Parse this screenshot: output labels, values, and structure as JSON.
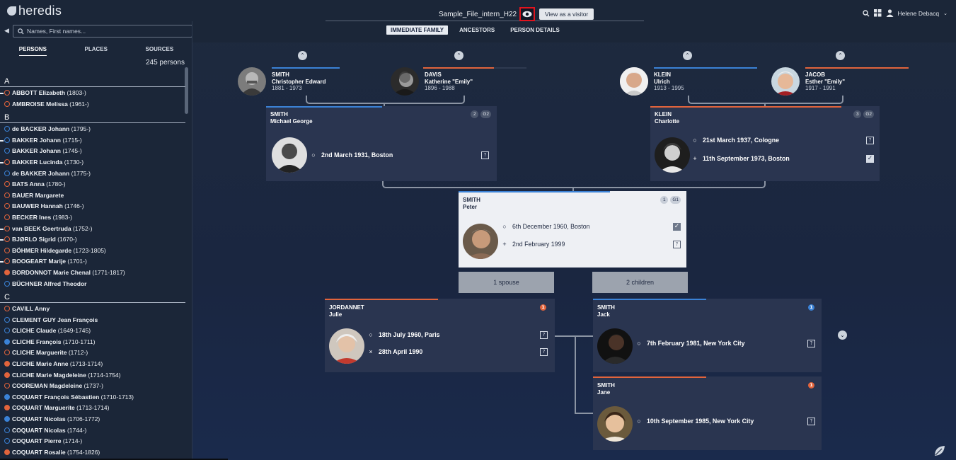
{
  "app": {
    "logo": "heredis"
  },
  "header": {
    "filename": "Sample_File_intern_H22",
    "visitor_label": "View as a visitor",
    "tabs": [
      {
        "label": "IMMEDIATE FAMILY",
        "active": true
      },
      {
        "label": "ANCESTORS",
        "active": false
      },
      {
        "label": "PERSON DETAILS",
        "active": false
      }
    ],
    "user": "Helene Debacq"
  },
  "sidebar": {
    "search_placeholder": "Names, First names...",
    "tabs": [
      "PERSONS",
      "PLACES",
      "SOURCES"
    ],
    "count": "245 persons",
    "groups": [
      {
        "letter": "A",
        "items": [
          {
            "name": "ABBOTT Elizabeth",
            "dates": "(1803-)",
            "sex": "female",
            "filled": false,
            "bar": true
          },
          {
            "name": "AMBROISE Melissa",
            "dates": "(1961-)",
            "sex": "female",
            "filled": false,
            "bar": false
          }
        ]
      },
      {
        "letter": "B",
        "items": [
          {
            "name": "de BACKER Johann",
            "dates": "(1795-)",
            "sex": "male",
            "filled": false,
            "bar": false
          },
          {
            "name": "BAKKER Johann",
            "dates": "(1715-)",
            "sex": "male",
            "filled": false,
            "bar": true
          },
          {
            "name": "BAKKER Johann",
            "dates": "(1745-)",
            "sex": "male",
            "filled": false,
            "bar": false
          },
          {
            "name": "BAKKER Lucinda",
            "dates": "(1730-)",
            "sex": "female",
            "filled": false,
            "bar": true
          },
          {
            "name": "de BAKKER Johann",
            "dates": "(1775-)",
            "sex": "male",
            "filled": false,
            "bar": false
          },
          {
            "name": "BATS Anna",
            "dates": "(1780-)",
            "sex": "female",
            "filled": false,
            "bar": false
          },
          {
            "name": "BAUER Margarete",
            "dates": "",
            "sex": "female",
            "filled": false,
            "bar": false
          },
          {
            "name": "BAUWER Hannah",
            "dates": "(1746-)",
            "sex": "female",
            "filled": false,
            "bar": false
          },
          {
            "name": "BECKER Ines",
            "dates": "(1983-)",
            "sex": "female",
            "filled": false,
            "bar": false
          },
          {
            "name": "van BEEK Geertruda",
            "dates": "(1752-)",
            "sex": "female",
            "filled": false,
            "bar": true
          },
          {
            "name": "BJØRLO Sigrid",
            "dates": "(1670-)",
            "sex": "female",
            "filled": false,
            "bar": true
          },
          {
            "name": "BÖHMER Hildegarde",
            "dates": "(1723-1805)",
            "sex": "female",
            "filled": false,
            "bar": false
          },
          {
            "name": "BOOGEART Marije",
            "dates": "(1701-)",
            "sex": "female",
            "filled": false,
            "bar": true
          },
          {
            "name": "BORDONNOT Marie Chenal",
            "dates": "(1771-1817)",
            "sex": "female",
            "filled": true,
            "bar": false
          },
          {
            "name": "BÜCHNER Alfred Theodor",
            "dates": "",
            "sex": "male",
            "filled": false,
            "bar": false
          }
        ]
      },
      {
        "letter": "C",
        "items": [
          {
            "name": "CAVILL Anny",
            "dates": "",
            "sex": "female",
            "filled": false,
            "bar": false
          },
          {
            "name": "CLEMENT GUY Jean François",
            "dates": "",
            "sex": "male",
            "filled": false,
            "bar": false
          },
          {
            "name": "CLICHE Claude",
            "dates": "(1649-1745)",
            "sex": "male",
            "filled": false,
            "bar": false
          },
          {
            "name": "CLICHE François",
            "dates": "(1710-1711)",
            "sex": "male",
            "filled": true,
            "bar": false
          },
          {
            "name": "CLICHE Marguerite",
            "dates": "(1712-)",
            "sex": "female",
            "filled": false,
            "bar": false
          },
          {
            "name": "CLICHE Marie Anne",
            "dates": "(1713-1714)",
            "sex": "female",
            "filled": true,
            "bar": false
          },
          {
            "name": "CLICHE Marie Magdeleine",
            "dates": "(1714-1754)",
            "sex": "female",
            "filled": true,
            "bar": false
          },
          {
            "name": "COOREMAN Magdeleine",
            "dates": "(1737-)",
            "sex": "female",
            "filled": false,
            "bar": false
          },
          {
            "name": "COQUART François Sébastien",
            "dates": "(1710-1713)",
            "sex": "male",
            "filled": true,
            "bar": false
          },
          {
            "name": "COQUART Marguerite",
            "dates": "(1713-1714)",
            "sex": "female",
            "filled": true,
            "bar": false
          },
          {
            "name": "COQUART Nicolas",
            "dates": "(1706-1772)",
            "sex": "male",
            "filled": true,
            "bar": false
          },
          {
            "name": "COQUART Nicolas",
            "dates": "(1744-)",
            "sex": "male",
            "filled": false,
            "bar": false
          },
          {
            "name": "COQUART Pierre",
            "dates": "(1714-)",
            "sex": "male",
            "filled": false,
            "bar": false
          },
          {
            "name": "COQUART Rosalie",
            "dates": "(1754-1826)",
            "sex": "female",
            "filled": true,
            "bar": false
          }
        ]
      }
    ]
  },
  "grandparents": [
    {
      "surname": "SMITH",
      "given": "Christopher Edward",
      "years": "1881 - 1973"
    },
    {
      "surname": "DAVIS",
      "given": "Katherine \"Emily\"",
      "years": "1896 - 1988"
    },
    {
      "surname": "KLEIN",
      "given": "Ulrich",
      "years": "1913 - 1995"
    },
    {
      "surname": "JACOB",
      "given": "Esther \"Emily\"",
      "years": "1917 - 1991"
    }
  ],
  "parents": {
    "father": {
      "surname": "SMITH",
      "given": "Michael George",
      "badge1": "2",
      "badge2": "G2",
      "birth": "2nd March 1931, Boston"
    },
    "mother": {
      "surname": "KLEIN",
      "given": "Charlotte",
      "badge1": "3",
      "badge2": "G2",
      "birth": "21st March 1937, Cologne",
      "death": "11th September 1973, Boston"
    }
  },
  "main": {
    "surname": "SMITH",
    "given": "Peter",
    "badge1": "1",
    "badge2": "G1",
    "birth": "6th December 1960, Boston",
    "death": "2nd February 1999"
  },
  "family_buttons": {
    "spouse": "1 spouse",
    "children": "2 children"
  },
  "spouse": {
    "surname": "JORDANNET",
    "given": "Julie",
    "num": "1",
    "birth": "18th July 1960, Paris",
    "marriage": "28th April 1990"
  },
  "children": [
    {
      "surname": "SMITH",
      "given": "Jack",
      "num": "1",
      "birth": "7th February 1981, New York City"
    },
    {
      "surname": "SMITH",
      "given": "Jane",
      "num": "1",
      "birth": "10th September 1985, New York City"
    }
  ],
  "colors": {
    "male": "#3b82d6",
    "female": "#e2643c",
    "card": "#2a3550"
  }
}
